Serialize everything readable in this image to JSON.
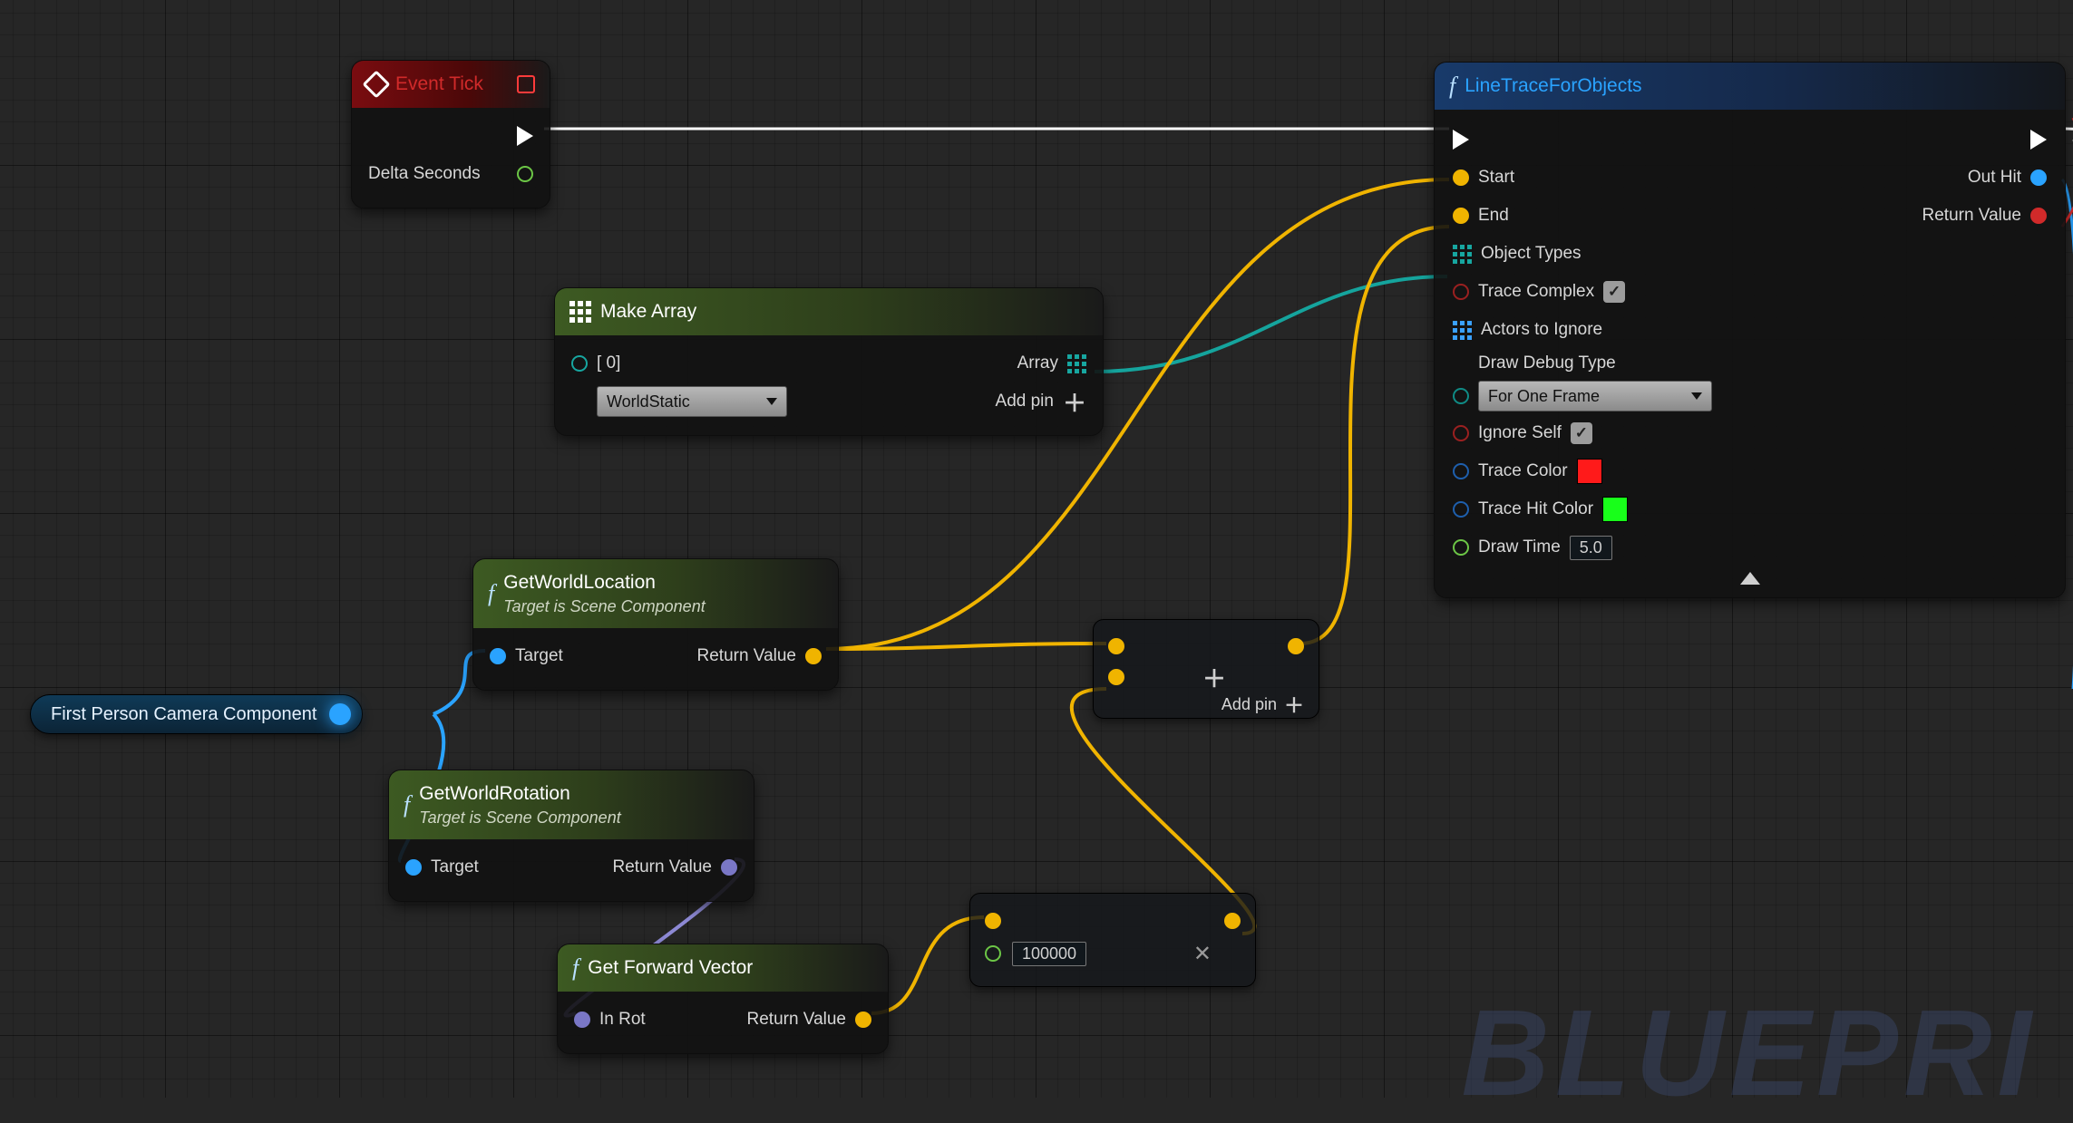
{
  "watermark": "BLUEPRI",
  "nodes": {
    "event_tick": {
      "title": "Event Tick",
      "out_delta": "Delta Seconds"
    },
    "make_array": {
      "title": "Make Array",
      "idx_label": "[ 0]",
      "option": "WorldStatic",
      "out_label": "Array",
      "add_pin": "Add pin"
    },
    "get_world_location": {
      "title": "GetWorldLocation",
      "sub": "Target is Scene Component",
      "in": "Target",
      "out": "Return Value"
    },
    "get_world_rotation": {
      "title": "GetWorldRotation",
      "sub": "Target is Scene Component",
      "in": "Target",
      "out": "Return Value"
    },
    "get_forward_vector": {
      "title": "Get Forward Vector",
      "in": "In Rot",
      "out": "Return Value"
    },
    "camera_var": {
      "label": "First Person Camera Component"
    },
    "mult": {
      "value": "100000"
    },
    "add": {
      "add_pin": "Add pin"
    },
    "line_trace": {
      "title": "LineTraceForObjects",
      "start": "Start",
      "end": "End",
      "obj_types": "Object Types",
      "trace_complex": "Trace Complex",
      "actors_ignore": "Actors to Ignore",
      "draw_debug_type": "Draw Debug Type",
      "draw_debug_option": "For One Frame",
      "ignore_self": "Ignore Self",
      "trace_color": "Trace Color",
      "trace_hit_color": "Trace Hit Color",
      "draw_time": "Draw Time",
      "draw_time_val": "5.0",
      "out_hit": "Out Hit",
      "return_value": "Return Value",
      "colors": {
        "trace": "#ff1a1a",
        "hit": "#18ff1a"
      }
    }
  }
}
